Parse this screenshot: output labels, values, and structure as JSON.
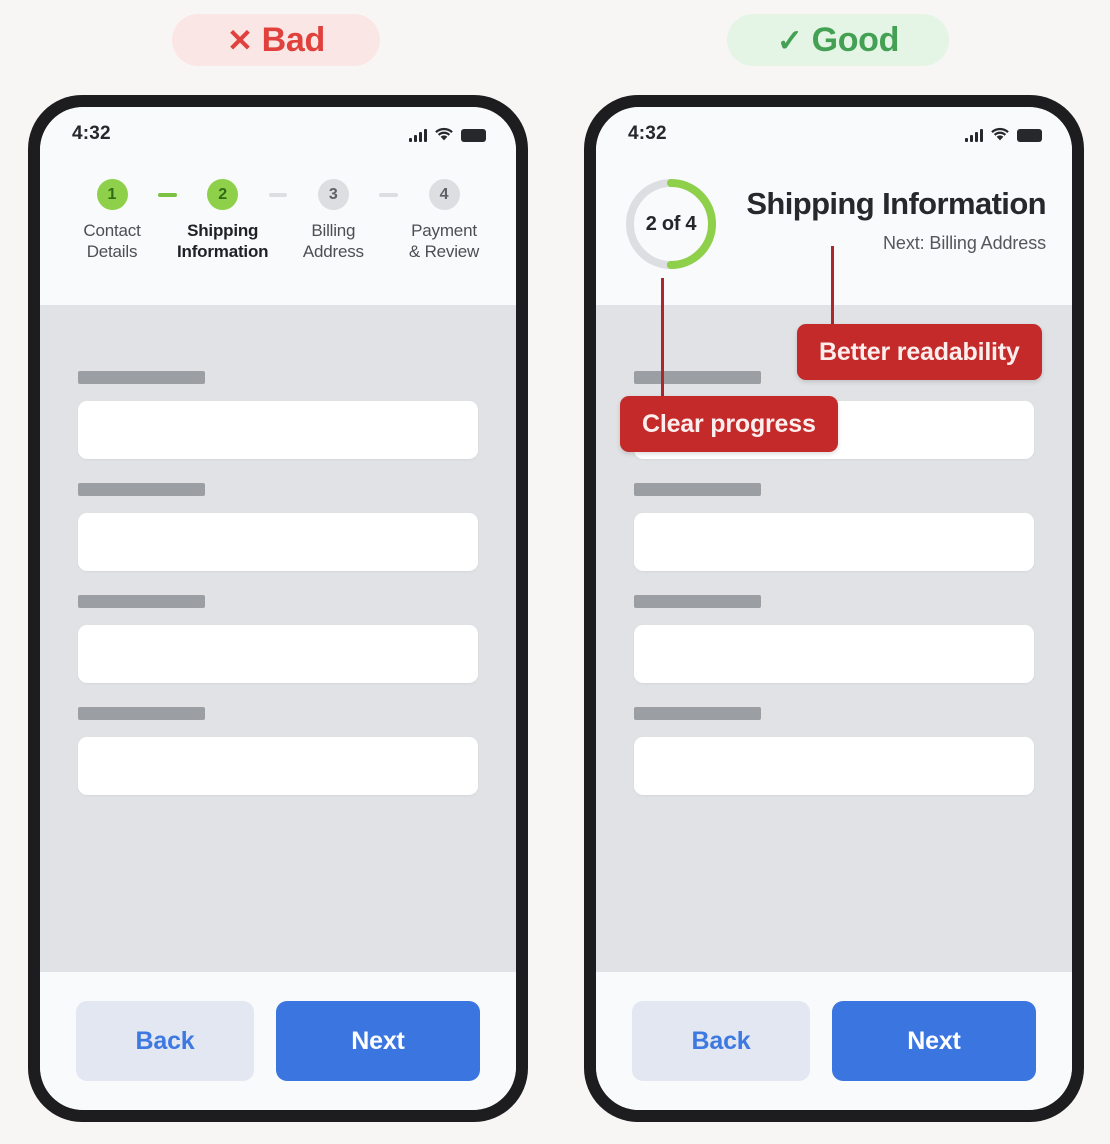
{
  "page": {
    "background": "#f7f6f5"
  },
  "badges": {
    "bad": {
      "mark": "✕",
      "label": "Bad",
      "bg": "#fbe6e6",
      "fg": "#e0413c"
    },
    "good": {
      "mark": "✓",
      "label": "Good",
      "bg": "#e4f5e6",
      "fg": "#44a052"
    }
  },
  "status_bar": {
    "time": "4:32",
    "icons": [
      "signal-bars-icon",
      "wifi-icon",
      "battery-icon"
    ]
  },
  "bad_phone": {
    "stepper": {
      "accent_done": "#8ed04a",
      "accent_idle": "#dcdee1",
      "steps": [
        {
          "number": "1",
          "label": "Contact\nDetails",
          "line1": "Contact",
          "line2": "Details",
          "state": "done"
        },
        {
          "number": "2",
          "label": "Shipping\nInformation",
          "line1": "Shipping",
          "line2": "Information",
          "state": "current"
        },
        {
          "number": "3",
          "label": "Billing\nAddress",
          "line1": "Billing",
          "line2": "Address",
          "state": "upcoming"
        },
        {
          "number": "4",
          "label": "Payment\n& Review",
          "line1": "Payment",
          "line2": "& Review",
          "state": "upcoming"
        }
      ]
    },
    "form_fields": [
      {
        "label": "",
        "value": "",
        "placeholder": ""
      },
      {
        "label": "",
        "value": "",
        "placeholder": ""
      },
      {
        "label": "",
        "value": "",
        "placeholder": ""
      },
      {
        "label": "",
        "value": "",
        "placeholder": ""
      }
    ],
    "actions": {
      "back_label": "Back",
      "next_label": "Next"
    }
  },
  "good_phone": {
    "progress": {
      "ring_text": "2 of 4",
      "current_step": 2,
      "total_steps": 4,
      "percent": 50,
      "ring_color": "#8ed04a",
      "track_color": "#dcdee1"
    },
    "title": "Shipping Information",
    "next_hint": "Next: Billing Address",
    "form_fields": [
      {
        "label": "",
        "value": "",
        "placeholder": ""
      },
      {
        "label": "",
        "value": "",
        "placeholder": ""
      },
      {
        "label": "",
        "value": "",
        "placeholder": ""
      },
      {
        "label": "",
        "value": "",
        "placeholder": ""
      }
    ],
    "actions": {
      "back_label": "Back",
      "next_label": "Next"
    }
  },
  "annotations": {
    "color": "#c42a2a",
    "items": [
      {
        "text": "Clear progress",
        "target": "progress-ring"
      },
      {
        "text": "Better readability",
        "target": "screen-title"
      }
    ]
  }
}
